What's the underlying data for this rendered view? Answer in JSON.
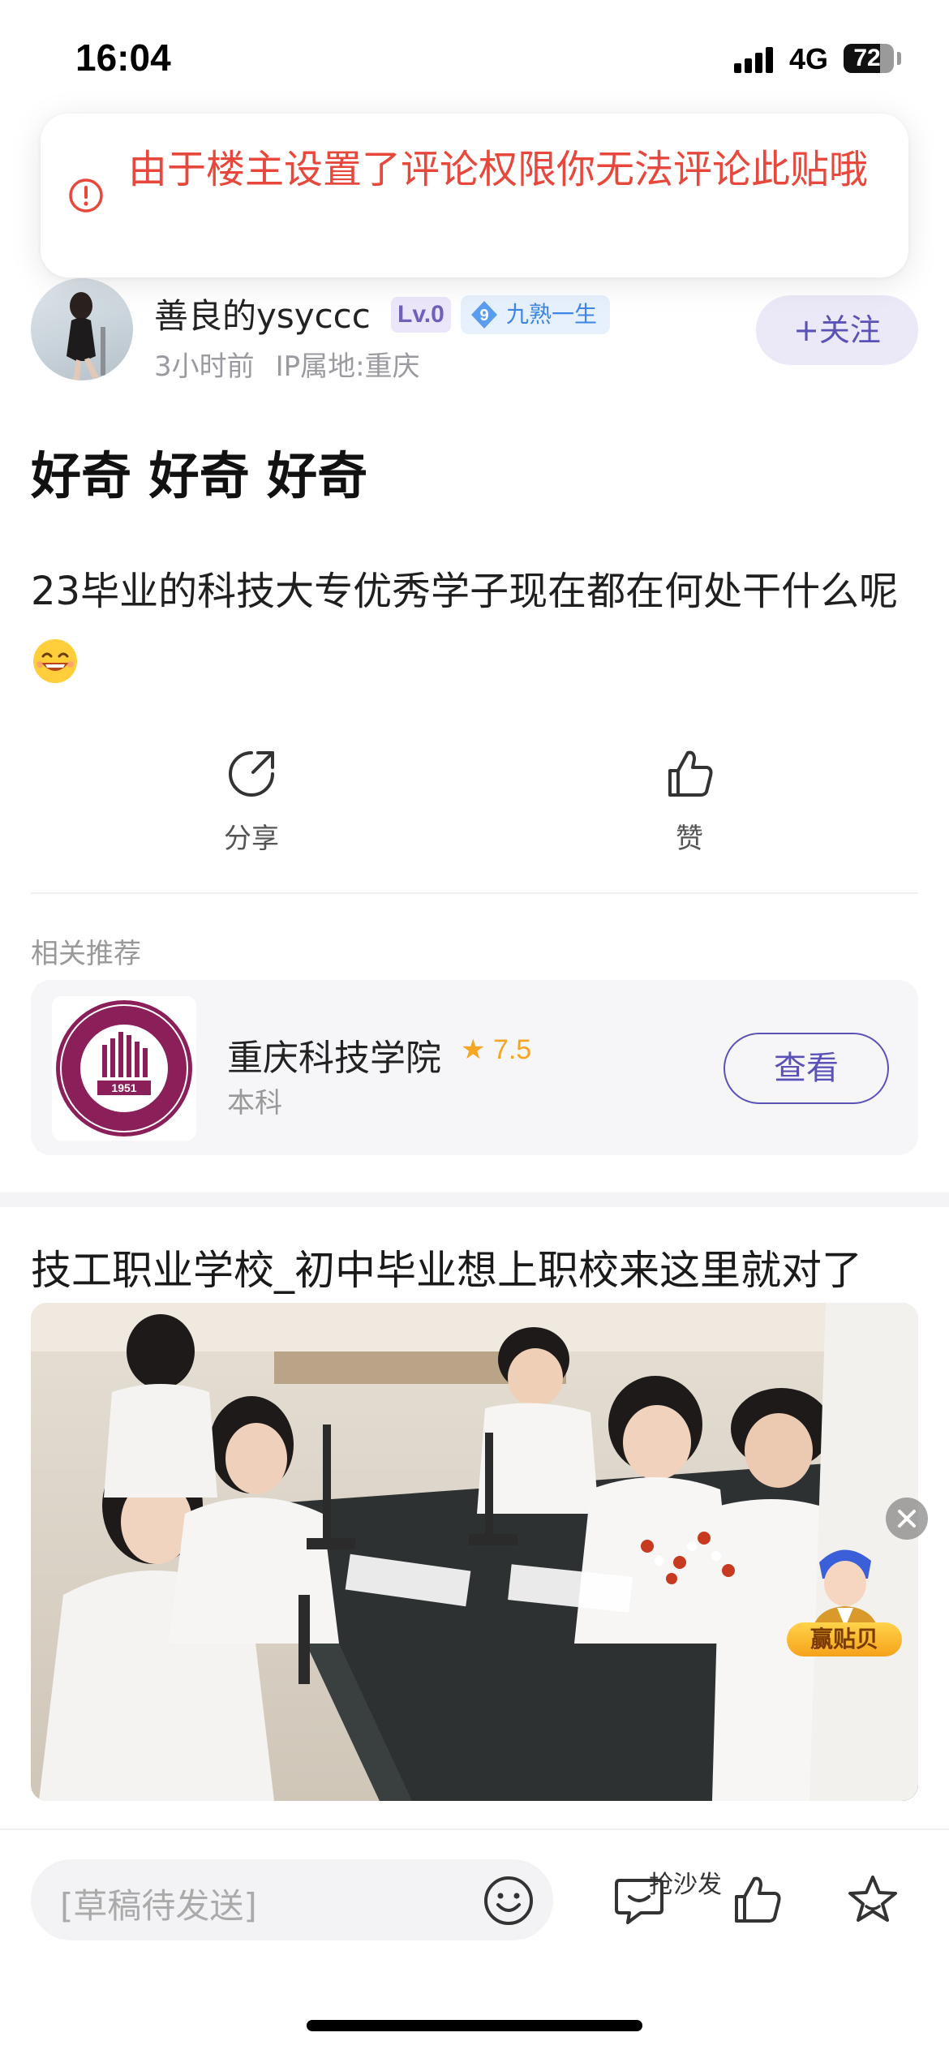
{
  "status_bar": {
    "time": "16:04",
    "network": "4G",
    "battery": "72",
    "battery_level": 0.72
  },
  "toast": {
    "message": "由于楼主设置了评论权限你无法评论此贴哦",
    "color": "#e8473c"
  },
  "author": {
    "name": "善良的ysyccc",
    "level": "Lv.0",
    "fan_level": "9",
    "fan_title": "九熟一生",
    "time": "3小时前",
    "ip": "IP属地:重庆",
    "follow_label": "+关注"
  },
  "post": {
    "title": "好奇 好奇 好奇",
    "body": "23毕业的科技大专优秀学子现在都在何处干什么呢"
  },
  "actions": {
    "share_label": "分享",
    "like_label": "赞"
  },
  "related": {
    "section_label": "相关推荐",
    "school": {
      "name": "重庆科技学院",
      "rating": "7.5",
      "type": "本科",
      "view_label": "查看",
      "logo_year": "1951"
    }
  },
  "ad": {
    "title": "技工职业学校_初中毕业想上职校来这里就对了"
  },
  "float_promo": {
    "label": "赢贴贝"
  },
  "bottom_bar": {
    "draft_placeholder": "[草稿待发送]",
    "sofa_label": "抢沙发"
  },
  "colors": {
    "accent": "#5b52b8",
    "error": "#e8473c",
    "rating": "#f5a623"
  }
}
